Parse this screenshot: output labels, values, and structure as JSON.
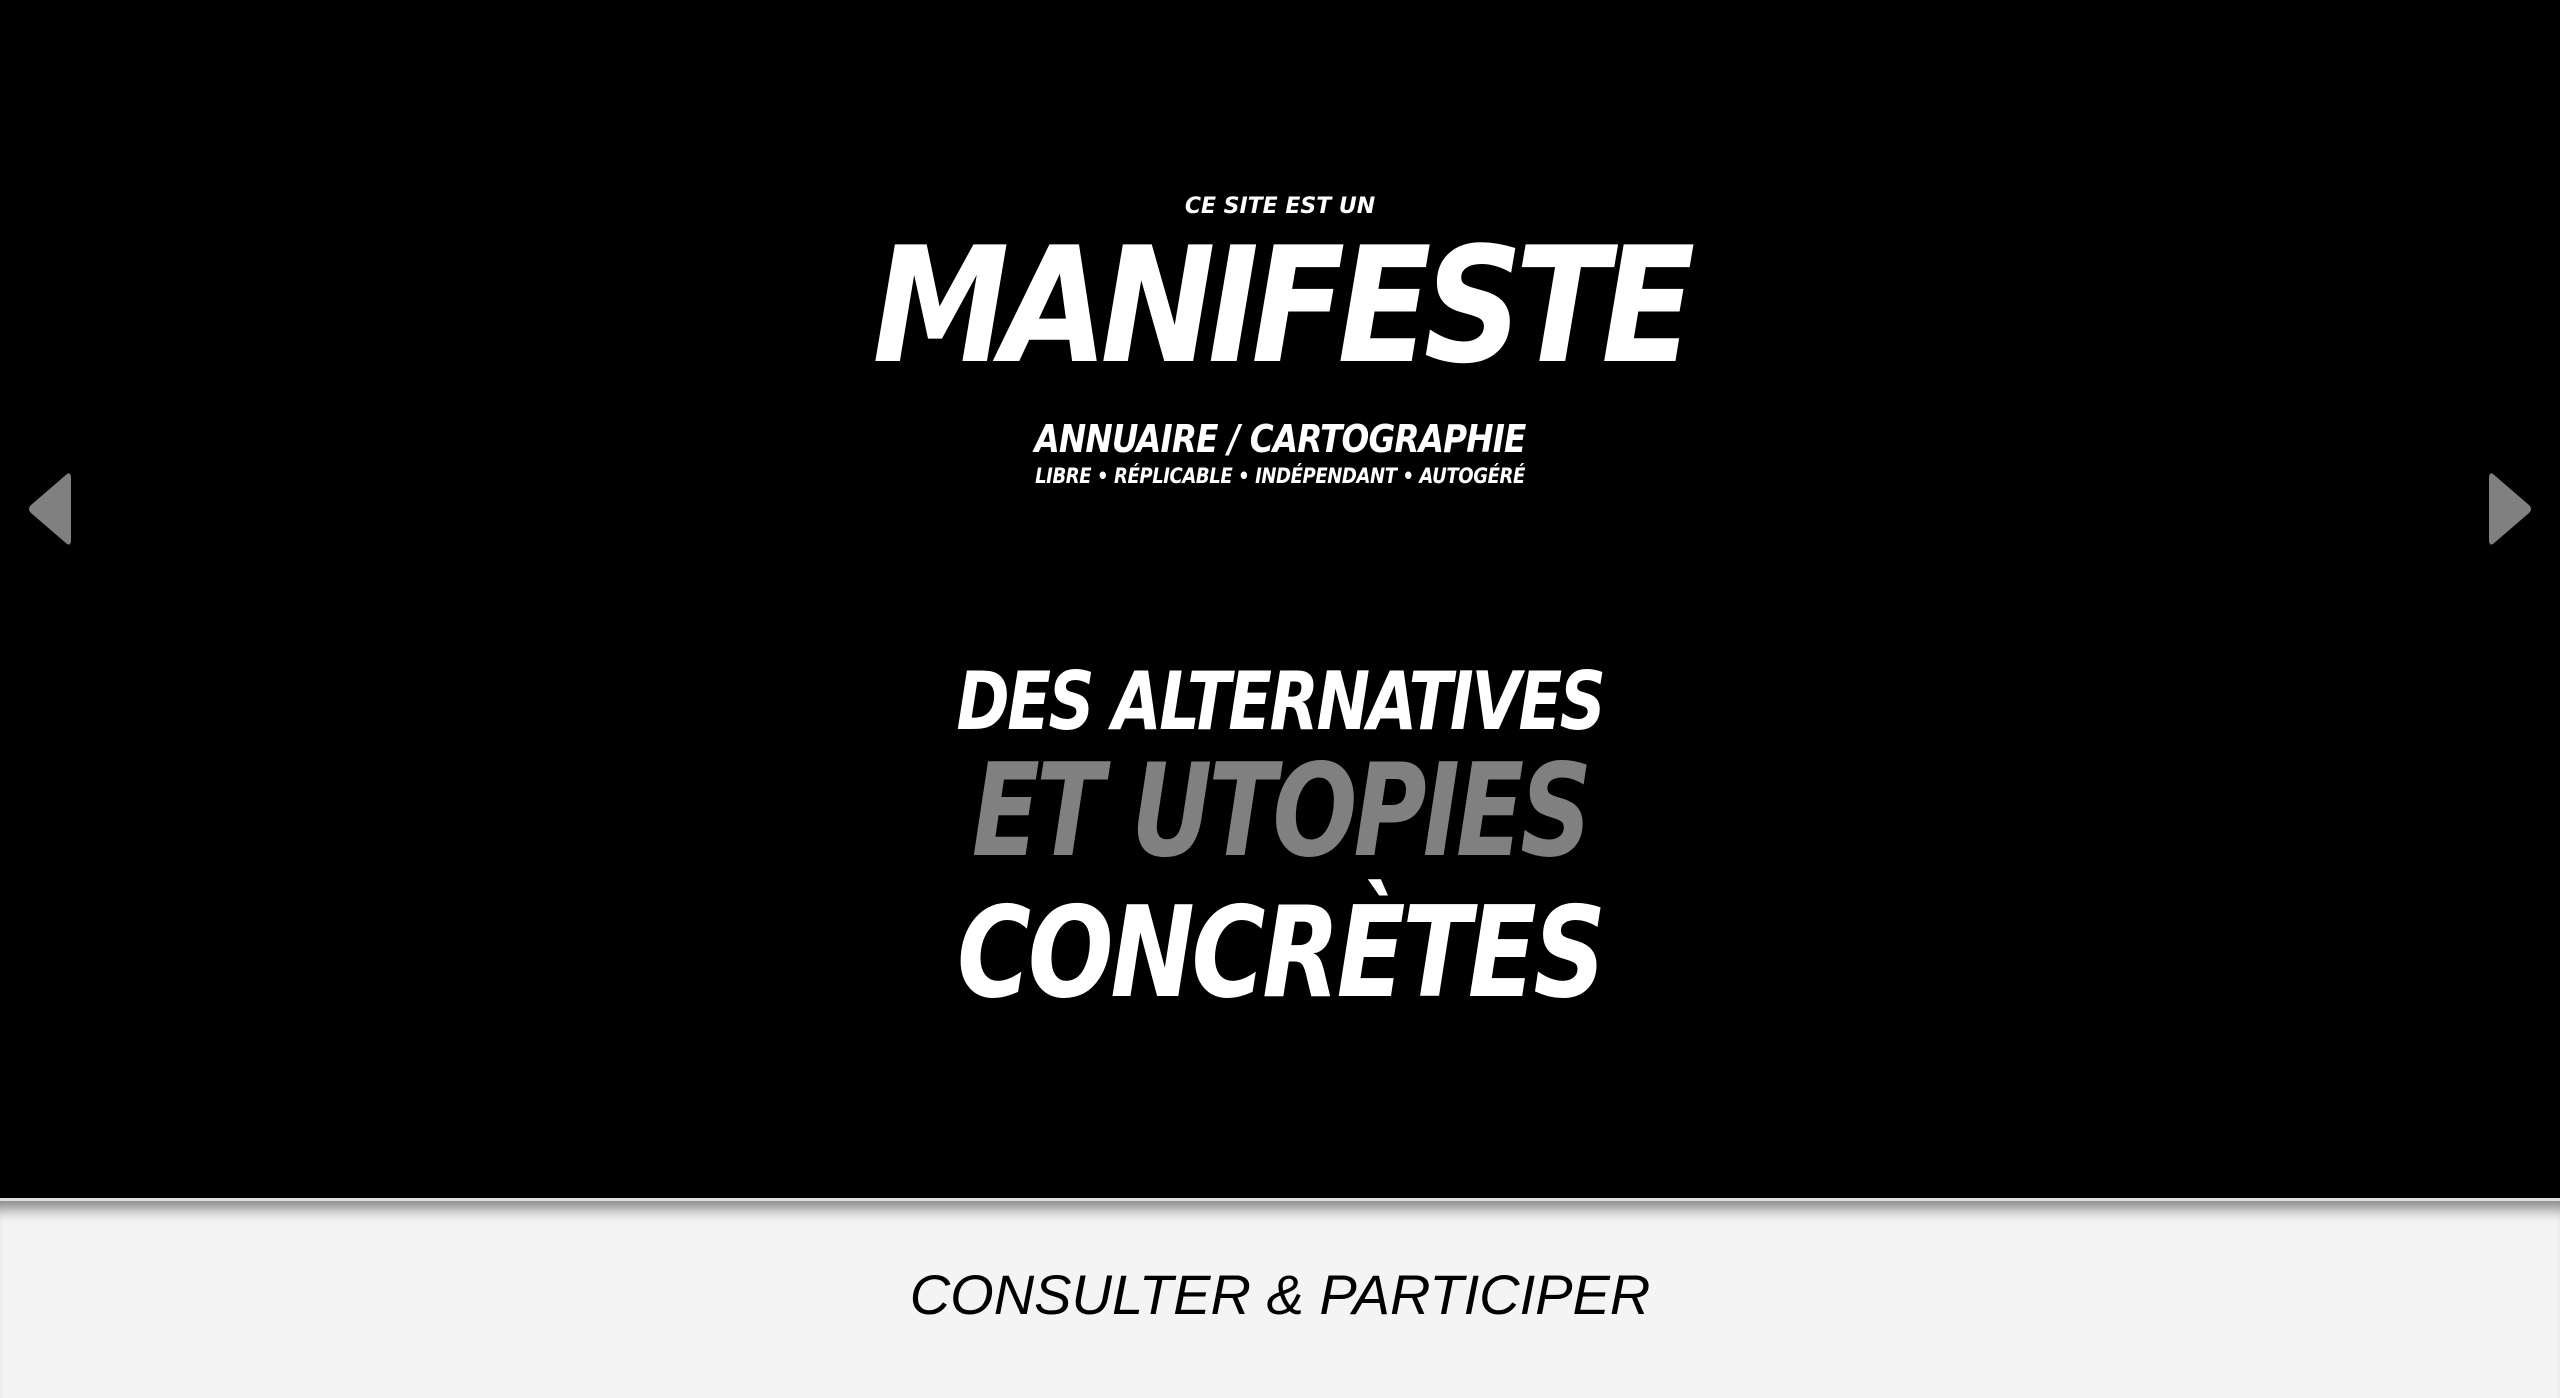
{
  "hero": {
    "intro": "CE SITE EST UN",
    "title": "MANIFESTE",
    "subtitle": "ANNUAIRE / CARTOGRAPHIE",
    "tags": "LIBRE • RÉPLICABLE • INDÉPENDANT • AUTOGÉRÉ",
    "tagline": {
      "line1": "DES ALTERNATIVES",
      "line2": "ET UTOPIES",
      "line3": "CONCRÈTES"
    }
  },
  "navigation": {
    "prev_icon": "triangle-left-icon",
    "next_icon": "triangle-right-icon"
  },
  "cta": {
    "label": "CONSULTER & PARTICIPER"
  },
  "colors": {
    "background": "#000000",
    "text": "#ffffff",
    "accent_gray": "#808080",
    "arrow": "#808080",
    "cta_background": "#f4f4f4",
    "cta_text": "#000000"
  }
}
